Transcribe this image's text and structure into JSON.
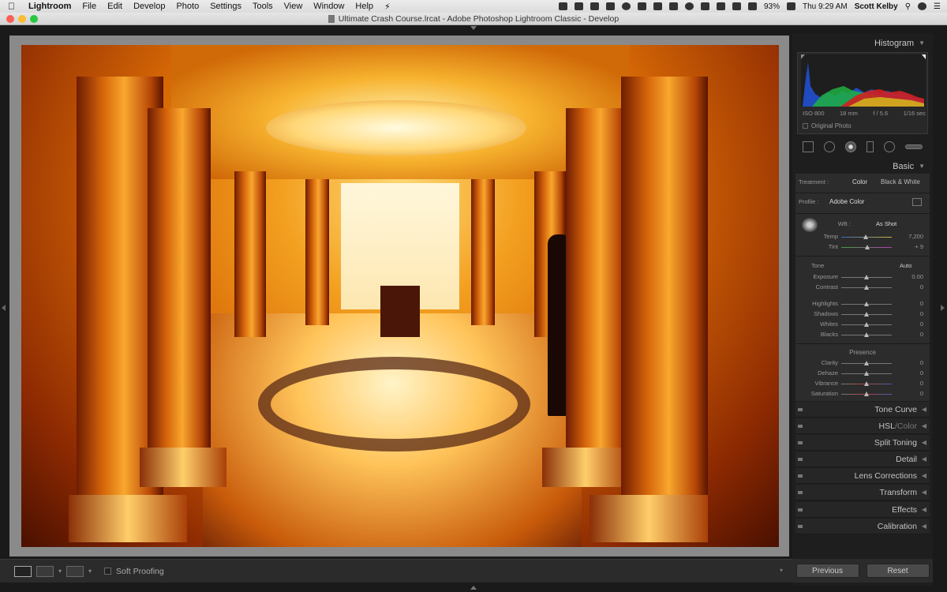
{
  "menubar": {
    "app": "Lightroom",
    "items": [
      "File",
      "Edit",
      "Develop",
      "Photo",
      "Settings",
      "Tools",
      "View",
      "Window",
      "Help"
    ],
    "battery": "93%",
    "clock": "Thu 9:29 AM",
    "user": "Scott Kelby"
  },
  "window": {
    "title": "Ultimate Crash Course.lrcat - Adobe Photoshop Lightroom Classic - Develop"
  },
  "toolbar": {
    "soft_proofing": "Soft Proofing"
  },
  "histogram": {
    "title": "Histogram",
    "iso": "ISO 800",
    "focal": "18 mm",
    "aperture": "f / 5.6",
    "shutter": "1/16 sec",
    "original_photo": "Original Photo"
  },
  "basic": {
    "title": "Basic",
    "treatment_label": "Treatment :",
    "treatment_color": "Color",
    "treatment_bw": "Black & White",
    "profile_label": "Profile :",
    "profile_value": "Adobe Color",
    "wb_label": "WB :",
    "wb_value": "As Shot",
    "temp_label": "Temp",
    "temp_value": "7,200",
    "tint_label": "Tint",
    "tint_value": "+ 9",
    "tone_label": "Tone",
    "auto_label": "Auto",
    "exposure_label": "Exposure",
    "exposure_value": "0.00",
    "contrast_label": "Contrast",
    "contrast_value": "0",
    "highlights_label": "Highlights",
    "highlights_value": "0",
    "shadows_label": "Shadows",
    "shadows_value": "0",
    "whites_label": "Whites",
    "whites_value": "0",
    "blacks_label": "Blacks",
    "blacks_value": "0",
    "presence_label": "Presence",
    "clarity_label": "Clarity",
    "clarity_value": "0",
    "dehaze_label": "Dehaze",
    "dehaze_value": "0",
    "vibrance_label": "Vibrance",
    "vibrance_value": "0",
    "saturation_label": "Saturation",
    "saturation_value": "0"
  },
  "panels": {
    "tone_curve": "Tone Curve",
    "hsl": "HSL",
    "hsl_sep": " / ",
    "color": "Color",
    "split_toning": "Split Toning",
    "detail": "Detail",
    "lens_corrections": "Lens Corrections",
    "transform": "Transform",
    "effects": "Effects",
    "calibration": "Calibration"
  },
  "buttons": {
    "previous": "Previous",
    "reset": "Reset"
  }
}
